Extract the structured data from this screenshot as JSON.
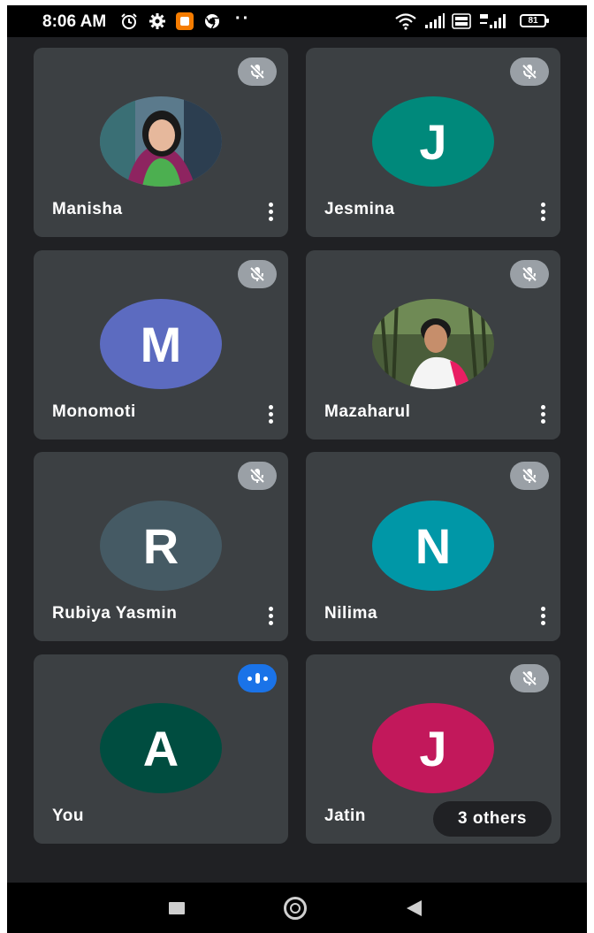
{
  "status_bar": {
    "time": "8:06 AM",
    "battery": "81",
    "icons": [
      "alarm-icon",
      "gear-icon",
      "orange-app-icon",
      "chrome-icon",
      "more-dots-icon",
      "wifi-icon",
      "signal-icon",
      "volte-icon",
      "4g-signal-icon",
      "battery-icon"
    ]
  },
  "participants": [
    {
      "name": "Manisha",
      "avatar": "photo",
      "muted": true,
      "menu": true
    },
    {
      "name": "Jesmina",
      "avatar": "initial",
      "initial": "J",
      "color": "#00897b",
      "muted": true,
      "menu": true
    },
    {
      "name": "Monomoti",
      "avatar": "initial",
      "initial": "M",
      "color": "#5c6bc0",
      "muted": true,
      "menu": true
    },
    {
      "name": "Mazaharul",
      "avatar": "photo",
      "muted": true,
      "menu": true
    },
    {
      "name": "Rubiya Yasmin",
      "avatar": "initial",
      "initial": "R",
      "color": "#455a64",
      "muted": true,
      "menu": true
    },
    {
      "name": "Nilima",
      "avatar": "initial",
      "initial": "N",
      "color": "#0097a7",
      "muted": true,
      "menu": true
    },
    {
      "name": "You",
      "avatar": "initial",
      "initial": "A",
      "color": "#004d40",
      "muted": false,
      "speaking": true,
      "menu": false
    },
    {
      "name": "Jatin",
      "avatar": "initial",
      "initial": "J",
      "color": "#c2185b",
      "muted": true,
      "menu": false,
      "others_label": "3 others"
    }
  ],
  "colors": {
    "background": "#202124",
    "tile": "#3c4043",
    "mic_badge": "#9aa0a6",
    "speaking_badge": "#1a73e8"
  },
  "nav_bar": {
    "icons": [
      "recent-apps-icon",
      "home-icon",
      "back-icon"
    ]
  }
}
